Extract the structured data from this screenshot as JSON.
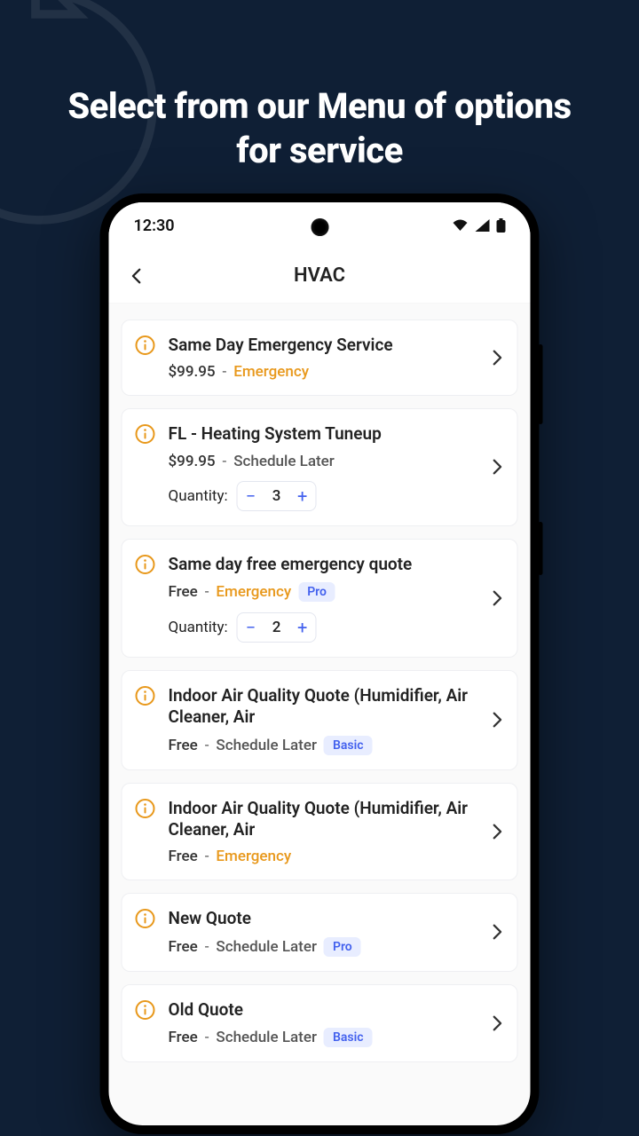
{
  "headline": "Select from our Menu of options for service",
  "statusbar": {
    "time": "12:30"
  },
  "appbar": {
    "title": "HVAC"
  },
  "labels": {
    "quantity": "Quantity:",
    "separator": "-"
  },
  "badges": {
    "pro": "Pro",
    "basic": "Basic"
  },
  "items": [
    {
      "title": "Same Day Emergency Service",
      "price": "$99.95",
      "schedule_text": "Emergency",
      "schedule_type": "emergency",
      "badge": null,
      "qty": null
    },
    {
      "title": "FL - Heating System Tuneup",
      "price": "$99.95",
      "schedule_text": "Schedule Later",
      "schedule_type": "later",
      "badge": null,
      "qty": "3"
    },
    {
      "title": "Same day free emergency quote",
      "price": "Free",
      "schedule_text": "Emergency",
      "schedule_type": "emergency",
      "badge": "pro",
      "qty": "2"
    },
    {
      "title": "Indoor Air Quality Quote (Humidifier, Air Cleaner, Air",
      "price": "Free",
      "schedule_text": "Schedule Later",
      "schedule_type": "later",
      "badge": "basic",
      "qty": null
    },
    {
      "title": "Indoor Air Quality Quote (Humidifier, Air Cleaner, Air",
      "price": "Free",
      "schedule_text": "Emergency",
      "schedule_type": "emergency",
      "badge": null,
      "qty": null
    },
    {
      "title": "New Quote",
      "price": "Free",
      "schedule_text": "Schedule Later",
      "schedule_type": "later",
      "badge": "pro",
      "qty": null
    },
    {
      "title": "Old Quote",
      "price": "Free",
      "schedule_text": "Schedule Later",
      "schedule_type": "later",
      "badge": "basic",
      "qty": null
    }
  ]
}
